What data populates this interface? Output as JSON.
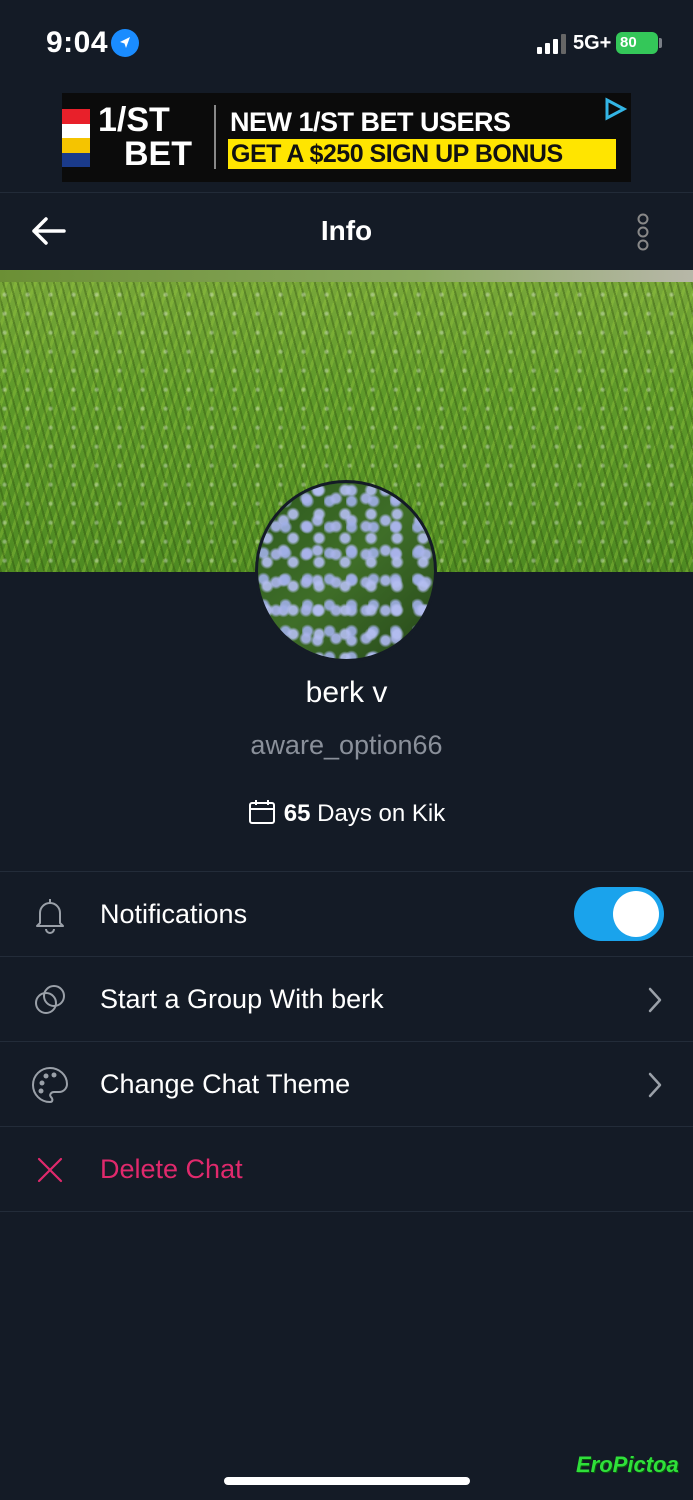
{
  "status_bar": {
    "time": "9:04",
    "network": "5G+",
    "battery": "80"
  },
  "ad": {
    "logo_line1": "1/ST",
    "logo_line2": "BET",
    "headline": "NEW 1/ST BET USERS",
    "subline": "GET A $250 SIGN UP BONUS",
    "colors": {
      "highlight": "#ffe500"
    }
  },
  "header": {
    "title": "Info"
  },
  "profile": {
    "display_name": "berk v",
    "username": "aware_option66",
    "days_count": "65",
    "days_label": " Days on Kik"
  },
  "settings": {
    "notifications": {
      "label": "Notifications",
      "enabled": true
    },
    "start_group": {
      "label": "Start a Group With berk"
    },
    "change_theme": {
      "label": "Change Chat Theme"
    },
    "delete_chat": {
      "label": "Delete Chat"
    }
  },
  "colors": {
    "background": "#141b26",
    "accent": "#1aa3ec",
    "danger": "#e0296c"
  },
  "icons": [
    "location-arrow-icon",
    "signal-icon",
    "battery-icon",
    "back-arrow-icon",
    "more-vertical-icon",
    "calendar-icon",
    "bell-icon",
    "group-icon",
    "palette-icon",
    "close-icon",
    "chevron-right-icon"
  ],
  "watermark": "EroPictoa"
}
